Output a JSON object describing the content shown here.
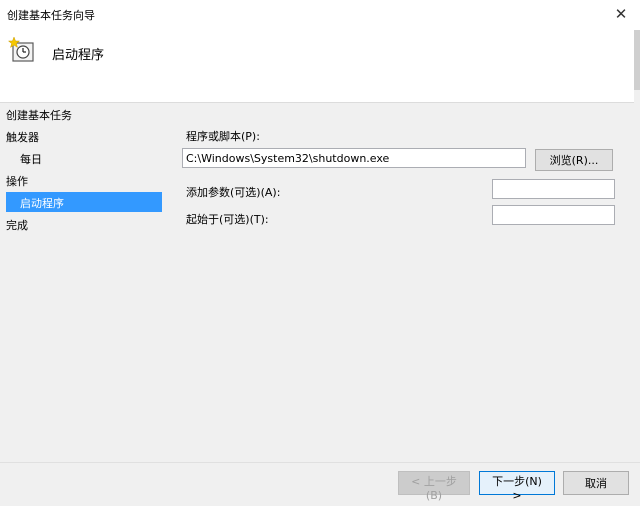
{
  "window": {
    "title": "创建基本任务向导",
    "close_label": "✕"
  },
  "header": {
    "title": "启动程序",
    "icon": "task-clock-icon"
  },
  "sidebar": {
    "items": [
      {
        "label": "创建基本任务"
      },
      {
        "label": "触发器"
      },
      {
        "label": "每日"
      },
      {
        "label": "操作"
      },
      {
        "label": "启动程序",
        "selected": true
      },
      {
        "label": "完成"
      }
    ]
  },
  "form": {
    "program_label": "程序或脚本(P):",
    "program_value": "C:\\Windows\\System32\\shutdown.exe",
    "browse_label": "浏览(R)...",
    "args_label": "添加参数(可选)(A):",
    "args_value": "",
    "startin_label": "起始于(可选)(T):",
    "startin_value": ""
  },
  "footer": {
    "back_label": "< 上一步(B)",
    "next_label": "下一步(N) >",
    "cancel_label": "取消"
  },
  "colors": {
    "selection": "#3399ff",
    "primary_border": "#0078d7"
  }
}
